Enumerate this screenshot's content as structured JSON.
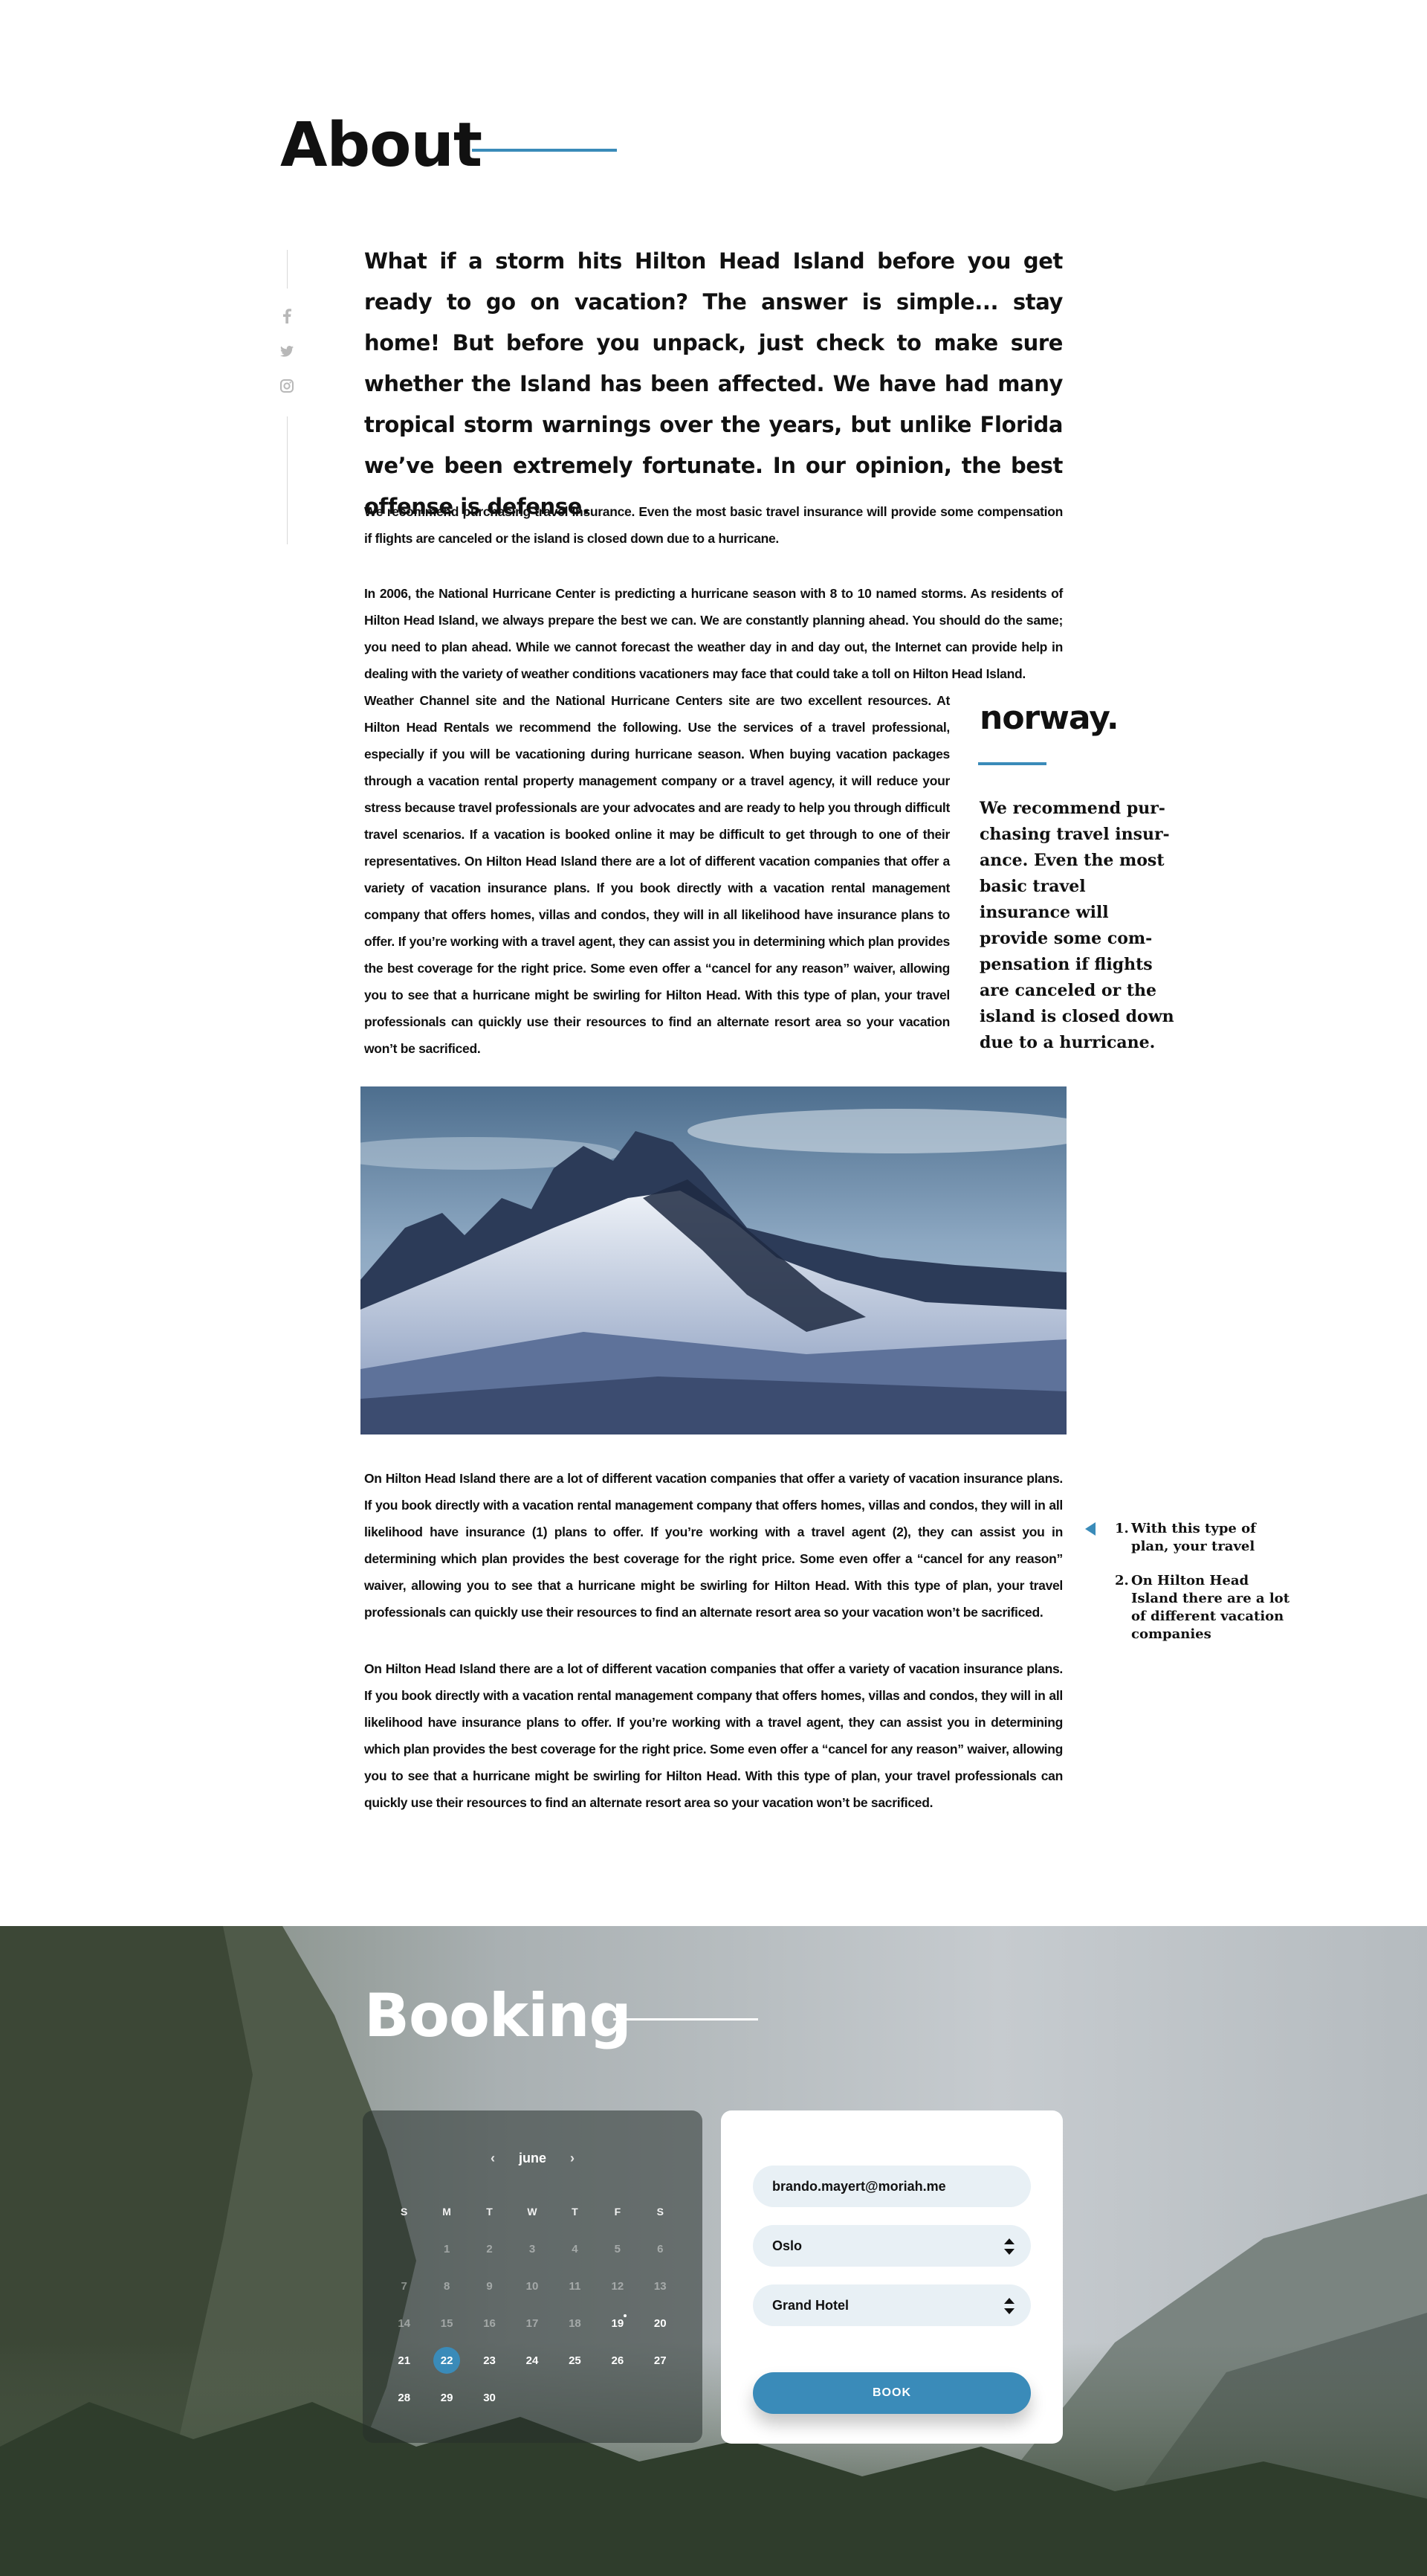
{
  "about": {
    "title": "About",
    "lead": "What if a storm hits Hilton Head Island before you get ready to go on vacation? The answer is simple... stay home! But before you unpack, just check to make sure whether the Island has been affected. We have had many tropical storm warnings over the years, but unlike Florida we’ve been extremely fortunate. In our opinion, the best offense is defense.",
    "paragraph1": "We recommend purchasing travel insurance. Even the most basic travel insurance will provide some compensation if flights are canceled or the island is closed down due to a hurricane.",
    "paragraph2a": "In 2006, the National Hurricane Center is predicting a hurricane season with 8 to 10 named storms. As residents of Hilton Head Island, we always prepare the best we can. We are constantly planning ahead. You should do the same; you need to plan ahead. While we cannot forecast the weather day in and day out, the Internet can provide help in dealing with the variety of weather conditions vacationers may face that could take a toll on Hilton Head Island.",
    "paragraph2b": "Weather Channel site and the National Hurricane Centers site are two excellent resources. At Hilton Head Rentals we recommend the following. Use the services of a travel professional, especially if you will be vacationing during hurricane season. When buying vacation packages through a vacation rental property management company or a travel agency, it will reduce your stress because travel professionals are your advocates and are ready to help you through difficult travel scenarios. If a vacation is booked online it may be difficult to get through to one of their representatives. On Hilton Head Island there are a lot of different vacation companies that offer a variety of vacation insurance plans. If you book directly with a vacation rental management company that offers homes, villas and condos, they will in all likelihood have insurance plans to offer. If you’re working with a travel agent, they can assist you in determining which plan provides the best coverage for the right price. Some even offer a “cancel for any reason” waiver, allowing you to see that a hurricane might be swirling for Hilton Head. With this type of plan, your travel professionals can quickly use their resources to find an alternate resort area so your vacation won’t be sacrificed.",
    "side_title": "norway.",
    "side_quote": "We recommend pur-chasing travel insur-ance. Even the most basic travel insurance will provide some com-pensation if flights are canceled or the island is closed down due to a hurricane.",
    "paragraph3": "On Hilton Head Island there are a lot of different vacation companies that offer a variety of vacation insurance plans. If you book directly with a vacation rental management company that offers homes, villas and condos, they will in all likelihood have insurance (1) plans to offer. If you’re working with a travel agent (2), they can assist you in determining which plan provides the best coverage for the right price. Some even offer a “cancel for any reason” waiver, allowing you to see that a hurricane might be swirling for Hilton Head. With this type of plan, your travel professionals can quickly use their resources to find an alternate resort area so your vacation won’t be sacrificed.",
    "paragraph4": "On Hilton Head Island there are a lot of different vacation companies that offer a variety of vacation insurance plans. If you book directly with a vacation rental management company that offers homes, villas and condos, they will in all likelihood have insurance plans to offer. If you’re working with a travel agent, they can assist you in determining which plan provides the best coverage for the right price. Some even offer a “cancel for any reason” waiver, allowing you to see that a hurricane might be swirling for Hilton Head. With this type of plan, your travel professionals can quickly use their resources to find an alternate resort area so your vacation won’t be sacrificed.",
    "footnotes": [
      {
        "num": "1.",
        "text": "With this type of plan, your travel"
      },
      {
        "num": "2.",
        "text": "On Hilton Head Island there are a lot of different vacation companies"
      }
    ],
    "social_icons": [
      "facebook-icon",
      "twitter-icon",
      "instagram-icon"
    ],
    "accent_color": "#3a8bb9"
  },
  "booking": {
    "title": "Booking",
    "calendar": {
      "month": "june",
      "prev": "‹",
      "next": "›",
      "weekdays": [
        "S",
        "M",
        "T",
        "W",
        "T",
        "F",
        "S"
      ],
      "weeks": [
        [
          "",
          "1",
          "2",
          "3",
          "4",
          "5",
          "6"
        ],
        [
          "7",
          "8",
          "9",
          "10",
          "11",
          "12",
          "13"
        ],
        [
          "14",
          "15",
          "16",
          "17",
          "18",
          "19",
          "20"
        ],
        [
          "21",
          "22",
          "23",
          "24",
          "25",
          "26",
          "27"
        ],
        [
          "28",
          "29",
          "30",
          "",
          "",
          "",
          ""
        ]
      ],
      "today": "19",
      "selected": "22",
      "first_available": "19"
    },
    "email_value": "brando.mayert@moriah.me",
    "city_value": "Oslo",
    "hotel_value": "Grand Hotel",
    "book_label": "BOOK"
  }
}
